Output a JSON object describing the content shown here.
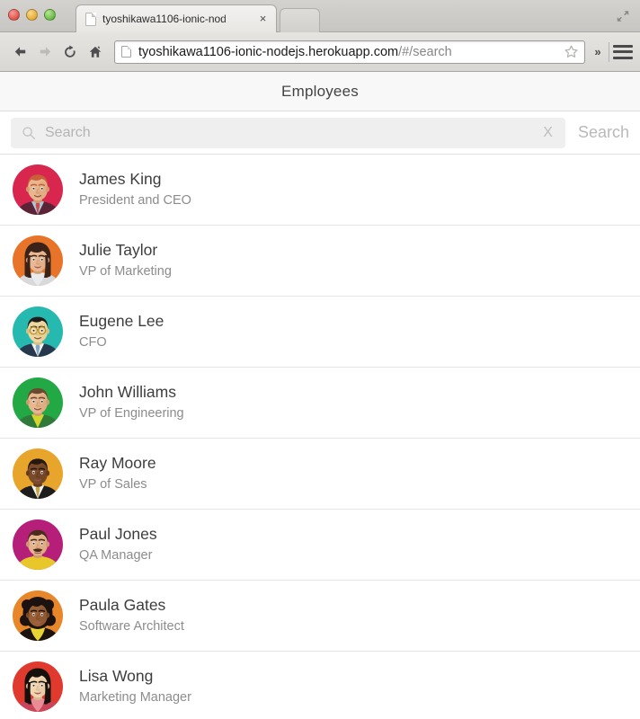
{
  "browser": {
    "tab": {
      "title": "tyoshikawa1106-ionic-nod",
      "close_label": "×",
      "favicon": "page-icon"
    },
    "toolbar": {
      "back_icon": "arrow-left-icon",
      "forward_icon": "arrow-right-icon",
      "reload_icon": "reload-icon",
      "home_icon": "home-icon",
      "url_main": "tyoshikawa1106-ionic-nodejs.herokuapp.com",
      "url_path": "/#/search",
      "bookmark_icon": "star-icon",
      "overflow_label": "»",
      "menu_icon": "hamburger-icon"
    },
    "fullscreen_icon": "fullscreen-expand-icon",
    "traffic_lights": [
      "close-red",
      "minimize-yellow",
      "zoom-green"
    ]
  },
  "app": {
    "header": {
      "title": "Employees"
    },
    "search": {
      "placeholder": "Search",
      "value": "",
      "clear_label": "X",
      "cancel_label": "Search",
      "magnifier_icon": "search-icon"
    },
    "employees": [
      {
        "name": "James King",
        "title": "President and CEO",
        "avatar": {
          "bg": "#d8264f",
          "skin": "#e8b58c",
          "skin_shadow": "#d39a6e",
          "hair": "#c8603a",
          "shirt": "#aac7e0",
          "jacket": "#5a2436",
          "tie": "#d14a4a",
          "type": "male-suit"
        }
      },
      {
        "name": "Julie Taylor",
        "title": "VP of Marketing",
        "avatar": {
          "bg": "#e8742a",
          "skin": "#e9b892",
          "skin_shadow": "#d49e74",
          "hair": "#3a2218",
          "shirt": "#e9eaec",
          "jacket": "#d8d9db",
          "tie": "#c9cacc",
          "type": "female-long"
        }
      },
      {
        "name": "Eugene Lee",
        "title": "CFO",
        "avatar": {
          "bg": "#26b9b0",
          "skin": "#efd89f",
          "skin_shadow": "#d9bf82",
          "hair": "#1d1d1d",
          "shirt": "#f2f2f2",
          "jacket": "#27384d",
          "tie": "#7fa8c4",
          "type": "male-glasses"
        }
      },
      {
        "name": "John Williams",
        "title": "VP of Engineering",
        "avatar": {
          "bg": "#22a844",
          "skin": "#e7b78f",
          "skin_shadow": "#d09c70",
          "hair": "#6a4a2e",
          "shirt": "#d4d62c",
          "jacket": "#2f7a3a",
          "tie": "#d4d62c",
          "type": "male-plain"
        }
      },
      {
        "name": "Ray Moore",
        "title": "VP of Sales",
        "avatar": {
          "bg": "#e8a52c",
          "skin": "#7b4a2a",
          "skin_shadow": "#643a1f",
          "hair": "#24180f",
          "shirt": "#f5f3ee",
          "jacket": "#1d1d1d",
          "tie": "#c2a24a",
          "type": "male-suit"
        }
      },
      {
        "name": "Paul Jones",
        "title": "QA Manager",
        "avatar": {
          "bg": "#b51f7a",
          "skin": "#e6b48c",
          "skin_shadow": "#cf9a70",
          "hair": "#4a2c1c",
          "shirt": "#e8c72a",
          "jacket": "#e8c72a",
          "tie": "#e8c72a",
          "type": "male-mustache"
        }
      },
      {
        "name": "Paula Gates",
        "title": "Software Architect",
        "avatar": {
          "bg": "#e8862a",
          "skin": "#9a5f35",
          "skin_shadow": "#7e4b27",
          "hair": "#1c1310",
          "shirt": "#e8d335",
          "jacket": "#1c1310",
          "tie": "#e8d335",
          "type": "female-curly"
        }
      },
      {
        "name": "Lisa Wong",
        "title": "Marketing Manager",
        "avatar": {
          "bg": "#e03a2f",
          "skin": "#f0d5ae",
          "skin_shadow": "#d9ba92",
          "hair": "#16100d",
          "shirt": "#e98c96",
          "jacket": "#c9455a",
          "tie": "#e98c96",
          "type": "female-straight"
        }
      }
    ]
  }
}
